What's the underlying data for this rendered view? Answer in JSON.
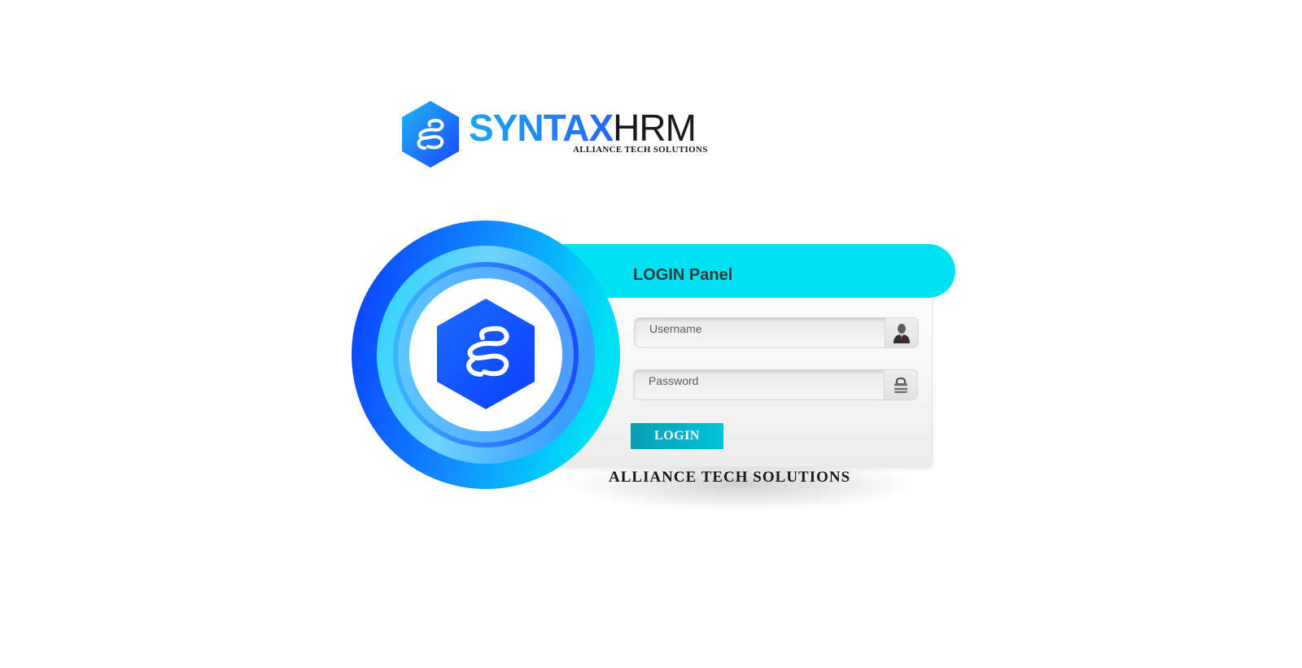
{
  "brand": {
    "name_primary": "SYNTAX",
    "name_secondary": "HRM",
    "tagline": "ALLIANCE TECH SOLUTIONS"
  },
  "login_panel": {
    "title": "LOGIN Panel",
    "username": {
      "value": "",
      "placeholder": "Username",
      "icon": "user-icon"
    },
    "password": {
      "value": "",
      "placeholder": "Password",
      "icon": "lock-icon"
    },
    "submit_label": "LOGIN"
  },
  "footer": {
    "company": "ALLIANCE TECH SOLUTIONS"
  },
  "colors": {
    "accent_cyan": "#00e2f2",
    "brand_blue": "#1a6bff",
    "button_teal": "#0aafc6"
  }
}
